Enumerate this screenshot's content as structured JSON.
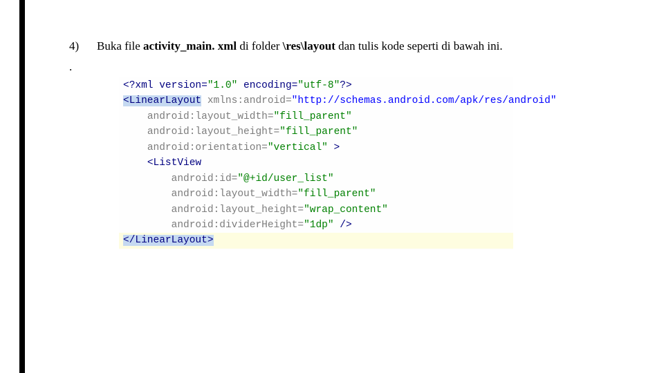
{
  "instruction": {
    "number": "4)",
    "pre": "Buka file ",
    "file": "activity_main. xml",
    "mid": " di folder ",
    "path": "\\res\\layout",
    "post": " dan tulis kode seperti di bawah ini."
  },
  "dot": ".",
  "code": {
    "l1": {
      "a": "<?xml version=",
      "b": "\"1.0\"",
      "c": " encoding=",
      "d": "\"utf-8\"",
      "e": "?>"
    },
    "l2": {
      "a": "<LinearLayout",
      "b": " xmlns:android=",
      "c": "\"http://schemas.android.com/apk/res/android\""
    },
    "l3": {
      "a": "android:layout_width=",
      "b": "\"fill_parent\""
    },
    "l4": {
      "a": "android:layout_height=",
      "b": "\"fill_parent\""
    },
    "l5": {
      "a": "android:orientation=",
      "b": "\"vertical\"",
      "c": " >"
    },
    "l6": {
      "a": "<ListView"
    },
    "l7": {
      "a": "android:id=",
      "b": "\"@+id/user_list\""
    },
    "l8": {
      "a": "android:layout_width=",
      "b": "\"fill_parent\""
    },
    "l9": {
      "a": "android:layout_height=",
      "b": "\"wrap_content\""
    },
    "l10": {
      "a": "android:dividerHeight=",
      "b": "\"1dp\"",
      "c": " />"
    },
    "l11": {
      "a": "</LinearLayout>"
    }
  }
}
